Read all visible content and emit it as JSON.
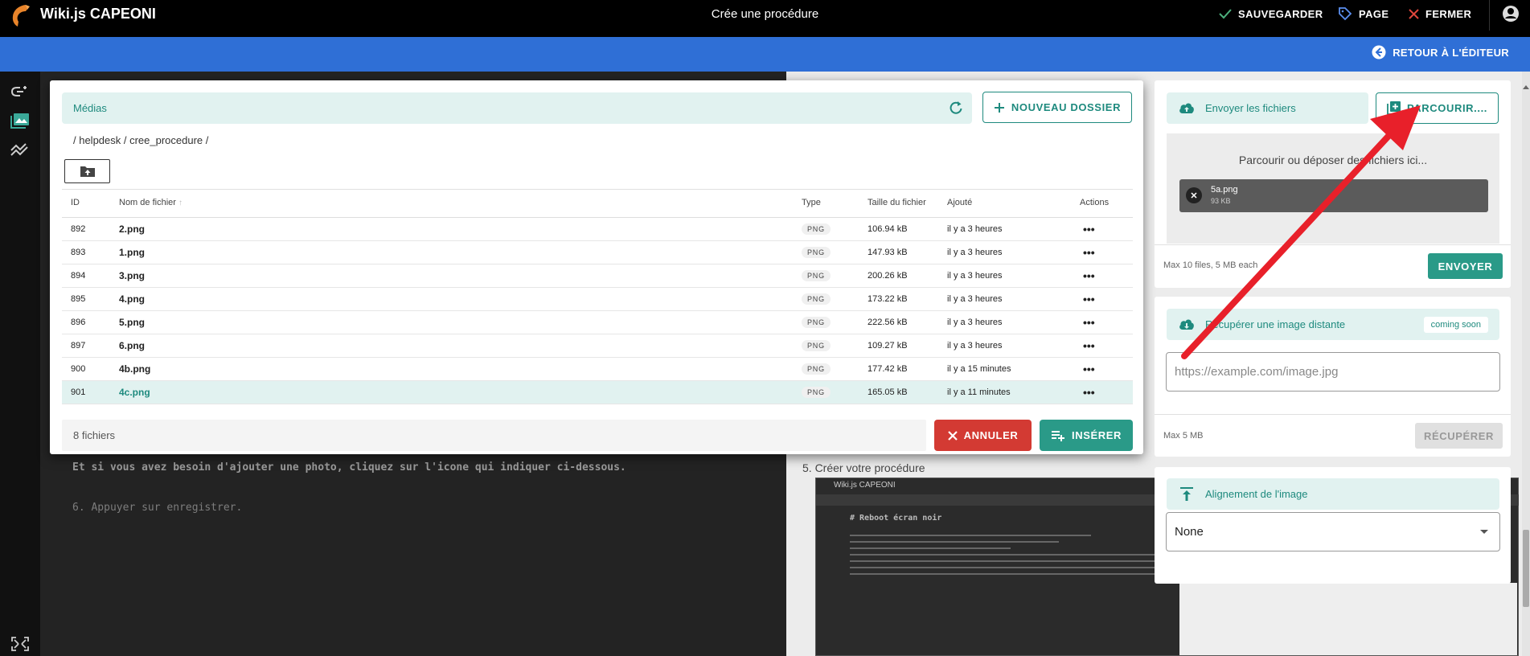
{
  "app": {
    "title": "Wiki.js CAPEONI",
    "page_heading": "Crée une procédure",
    "actions": {
      "save": "SAUVEGARDER",
      "page": "PAGE",
      "close": "FERMER"
    },
    "back_to_editor": "RETOUR À L'ÉDITEUR"
  },
  "colors": {
    "accent": "#1e8a7e",
    "blue_bar": "#2f6fd6",
    "cancel": "#d33a33",
    "annotation_arrow": "#e8202a"
  },
  "editor": {
    "lines": [
      "Et si vous avez besoin d'ajouter une photo, cliquez sur l'icone qui indiquer ci-dessous.",
      "6. Appuyer sur enregistrer."
    ]
  },
  "preview": {
    "heading": "5. Créer votre procédure",
    "screenshot": {
      "app_title": "Wiki.js CAPEONI",
      "heading": "# Reboot écran noir"
    }
  },
  "media": {
    "title": "Médias",
    "new_folder": "NOUVEAU DOSSIER",
    "breadcrumb": "/ helpdesk / cree_procedure /",
    "columns": {
      "id": "ID",
      "name": "Nom de fichier",
      "type": "Type",
      "size": "Taille du fichier",
      "added": "Ajouté",
      "actions": "Actions"
    },
    "files": [
      {
        "id": "892",
        "name": "2.png",
        "type": "PNG",
        "size": "106.94 kB",
        "added": "il y a 3 heures"
      },
      {
        "id": "893",
        "name": "1.png",
        "type": "PNG",
        "size": "147.93 kB",
        "added": "il y a 3 heures"
      },
      {
        "id": "894",
        "name": "3.png",
        "type": "PNG",
        "size": "200.26 kB",
        "added": "il y a 3 heures"
      },
      {
        "id": "895",
        "name": "4.png",
        "type": "PNG",
        "size": "173.22 kB",
        "added": "il y a 3 heures"
      },
      {
        "id": "896",
        "name": "5.png",
        "type": "PNG",
        "size": "222.56 kB",
        "added": "il y a 3 heures"
      },
      {
        "id": "897",
        "name": "6.png",
        "type": "PNG",
        "size": "109.27 kB",
        "added": "il y a 3 heures"
      },
      {
        "id": "900",
        "name": "4b.png",
        "type": "PNG",
        "size": "177.42 kB",
        "added": "il y a 15 minutes"
      },
      {
        "id": "901",
        "name": "4c.png",
        "type": "PNG",
        "size": "165.05 kB",
        "added": "il y a 11 minutes",
        "selected": true
      }
    ],
    "file_count": "8 fichiers",
    "cancel": "ANNULER",
    "insert": "INSÉRER"
  },
  "upload": {
    "title": "Envoyer les fichiers",
    "browse": "PARCOURIR....",
    "drop_text": "Parcourir ou déposer des fichiers ici...",
    "queued_file": {
      "name": "5a.png",
      "size": "93 KB"
    },
    "limits": "Max 10 files, 5 MB each",
    "send": "ENVOYER"
  },
  "remote": {
    "title": "Récupérer une image distante",
    "badge": "coming soon",
    "placeholder": "https://example.com/image.jpg",
    "limits": "Max 5 MB",
    "fetch": "RÉCUPÉRER"
  },
  "alignment": {
    "title": "Alignement de l'image",
    "value": "None"
  }
}
